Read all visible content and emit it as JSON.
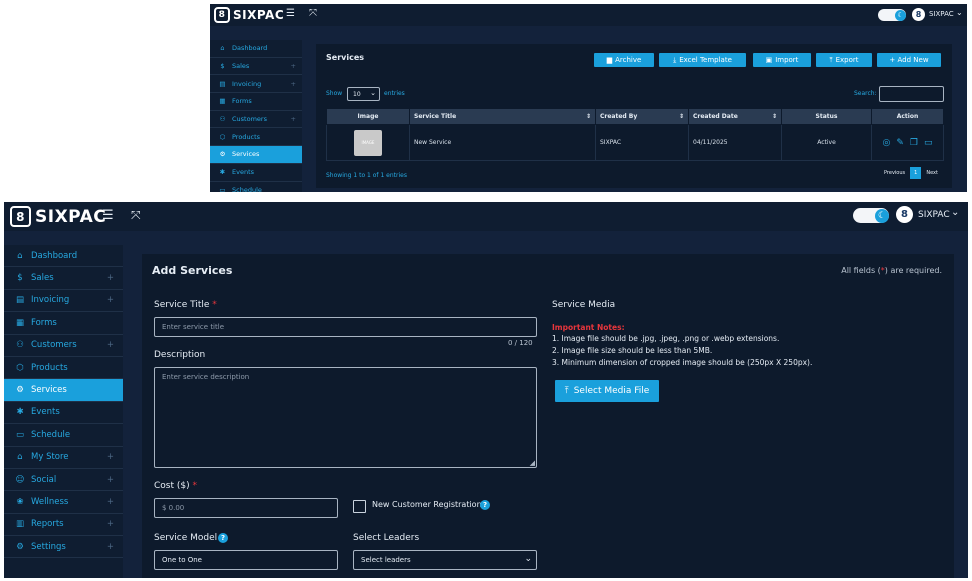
{
  "brand": {
    "name": "SIXPAC",
    "mark": "8"
  },
  "topbar": {
    "menu_icon": "☰",
    "expand_icon": "⤧",
    "user_name": "SIXPAC",
    "user_caret": "⌄"
  },
  "sidebar": {
    "items": [
      {
        "label": "Dashboard",
        "icon": "⌂",
        "plus": ""
      },
      {
        "label": "Sales",
        "icon": "$",
        "plus": "+"
      },
      {
        "label": "Invoicing",
        "icon": "▤",
        "plus": "+"
      },
      {
        "label": "Forms",
        "icon": "▦",
        "plus": ""
      },
      {
        "label": "Customers",
        "icon": "⚇",
        "plus": "+"
      },
      {
        "label": "Products",
        "icon": "⬡",
        "plus": ""
      },
      {
        "label": "Services",
        "icon": "⚙",
        "plus": ""
      },
      {
        "label": "Events",
        "icon": "✱",
        "plus": ""
      },
      {
        "label": "Schedule",
        "icon": "▭",
        "plus": ""
      },
      {
        "label": "My Store",
        "icon": "⌂",
        "plus": "+"
      },
      {
        "label": "Social",
        "icon": "☺",
        "plus": "+"
      },
      {
        "label": "Wellness",
        "icon": "❀",
        "plus": "+"
      },
      {
        "label": "Reports",
        "icon": "▥",
        "plus": "+"
      },
      {
        "label": "Settings",
        "icon": "⚙",
        "plus": "+"
      }
    ]
  },
  "list_page": {
    "title": "Services",
    "buttons": {
      "archive": "Archive",
      "excel": "Excel Template",
      "import": "Import",
      "export": "Export",
      "add_new": "+ Add New"
    },
    "show_label": "Show",
    "entries_value": "10",
    "entries_label": "entries",
    "search_label": "Search:",
    "columns": [
      "Image",
      "Service Title",
      "Created By",
      "Created Date",
      "Status",
      "Action"
    ],
    "rows": [
      {
        "image": "IMAGE",
        "title": "New Service",
        "created_by": "SIXPAC",
        "created_date": "04/11/2025",
        "status": "Active"
      }
    ],
    "showing": "Showing 1 to 1 of 1 entries",
    "pager": {
      "prev": "Previous",
      "page": "1",
      "next": "Next"
    },
    "action_icons": [
      "eye-icon",
      "pencil-icon",
      "copy-icon",
      "folder-icon"
    ]
  },
  "form": {
    "title": "Add Services",
    "all_fields_prefix": "All fields (",
    "all_fields_star": "*",
    "all_fields_suffix": ") are required.",
    "service_title_label": "Service Title",
    "service_title_placeholder": "Enter service title",
    "char_count": "0 / 120",
    "description_label": "Description",
    "description_placeholder": "Enter service description",
    "cost_label": "Cost ($)",
    "cost_placeholder": "$ 0.00",
    "new_customer_label": "New Customer Registration",
    "service_model_label": "Service Model",
    "service_model_value": "One to One",
    "select_leaders_label": "Select Leaders",
    "select_leaders_value": "Select leaders",
    "required_star": "*",
    "help_glyph": "?",
    "media": {
      "title": "Service Media",
      "notes_title": "Important Notes:",
      "notes": [
        "1. Image file should be .jpg, .jpeg, .png or .webp extensions.",
        "2. Image file size should be less than 5MB.",
        "3. Minimum dimension of cropped image should be (250px X 250px)."
      ],
      "select_button": "Select Media File"
    }
  },
  "colors": {
    "accent": "#1aa0dc",
    "background": "#13223b",
    "panel": "#0d1a2c",
    "required": "#e8363c"
  }
}
